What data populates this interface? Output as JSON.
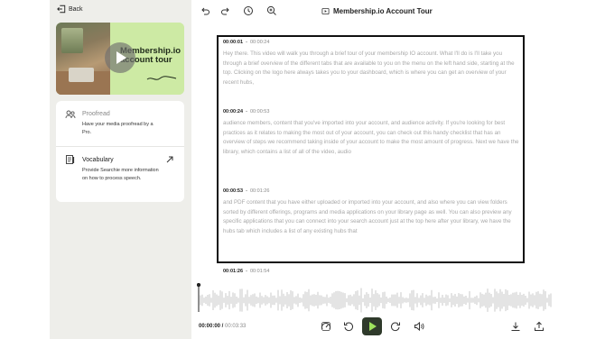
{
  "nav": {
    "back_label": "Back"
  },
  "video": {
    "title_line1": "Membership.io",
    "title_line2": "account tour"
  },
  "options": [
    {
      "title": "Proofread",
      "description": "Have your media proofread by a Pro.",
      "icon": "people-icon"
    },
    {
      "title": "Vocabulary",
      "description": "Provide Searchie more information on how to process speech.",
      "icon": "book-icon"
    }
  ],
  "toolbar": {
    "doc_title": "Membership.io Account Tour",
    "icons": [
      "undo-icon",
      "redo-icon",
      "history-icon",
      "search-zoom-icon"
    ]
  },
  "transcript": {
    "segments": [
      {
        "start": "00:00:01",
        "end": "00:00:24",
        "text": "Hey there. This video will walk you through a brief tour of your membership IO account. What I'll do is I'll take you through a brief overview of the different tabs that are available to you on the menu on the left hand side, starting at the top. Clicking on the logo here always takes you to your dashboard, which is where you can get an overview of your recent hubs,"
      },
      {
        "start": "00:00:24",
        "end": "00:00:53",
        "text": "audience members, content that you've imported into your account, and audience activity. If you're looking for best practices as it relates to making the most out of your account, you can check out this handy checklist that has an overview of steps we recommend taking inside of your account to make the most amount of progress. Next we have the library, which contains a list of all of the video, audio"
      },
      {
        "start": "00:00:53",
        "end": "00:01:26",
        "text": "and PDF content that you have either uploaded or imported into your account, and also where you can view folders sorted by different offerings, programs and media applications on your library page as well. You can also preview any specific applications that you can connect into your search account just at the top here after your library, we have the hubs tab which includes a list of any existing hubs that"
      },
      {
        "start": "00:01:26",
        "end": "00:01:54",
        "text": ""
      }
    ]
  },
  "player": {
    "current_time": "00:00:00 /",
    "total_time": "00:03:33",
    "progress": 0,
    "icons": [
      "speed-icon",
      "rewind-icon",
      "play-icon",
      "forward-icon",
      "volume-icon",
      "download-icon",
      "share-icon"
    ],
    "accent_color": "#9ee25d"
  }
}
